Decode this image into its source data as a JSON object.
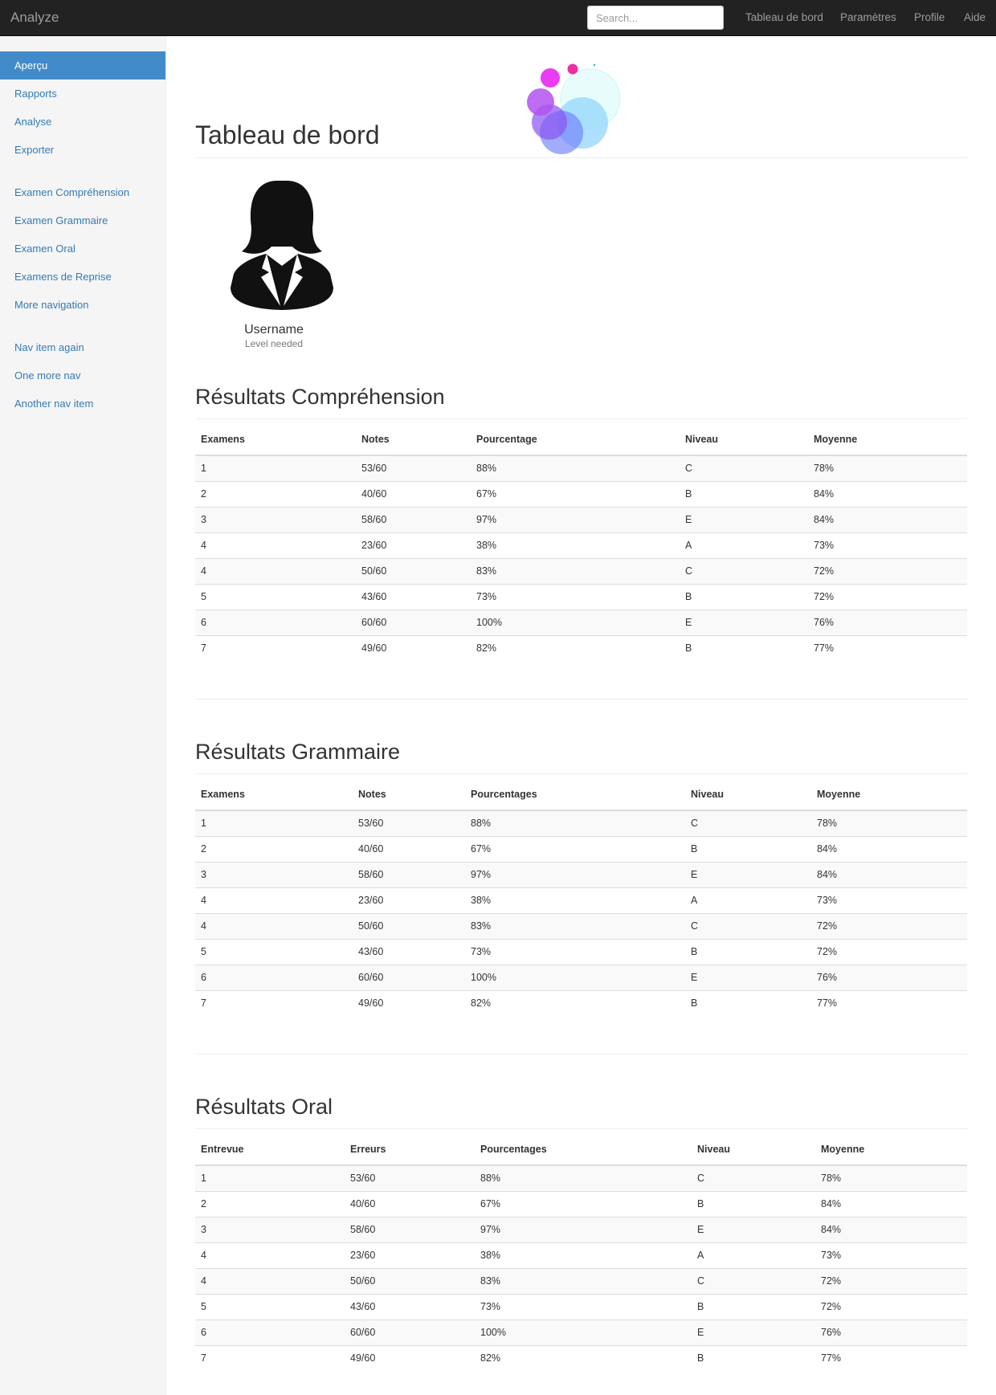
{
  "app": {
    "brand": "Analyze"
  },
  "search": {
    "placeholder": "Search..."
  },
  "topnav": [
    "Tableau de bord",
    "Paramètres",
    "Profile",
    "Aide"
  ],
  "sidebar": {
    "items": [
      "Aperçu",
      "Rapports",
      "Analyse",
      "Exporter",
      "Examen Compréhension",
      "Examen Grammaire",
      "Examen Oral",
      "Examens de Reprise",
      "More navigation",
      "Nav item again",
      "One more nav",
      "Another nav item"
    ],
    "active_index": 0
  },
  "page": {
    "title": "Tableau de bord"
  },
  "profile": {
    "username": "Username",
    "level": "Level needed"
  },
  "sections": [
    {
      "title": "Résultats Compréhension",
      "headers": [
        "Examens",
        "Notes",
        "Pourcentage",
        "Niveau",
        "Moyenne"
      ],
      "rows": [
        [
          "1",
          "53/60",
          "88%",
          "C",
          "78%"
        ],
        [
          "2",
          "40/60",
          "67%",
          "B",
          "84%"
        ],
        [
          "3",
          "58/60",
          "97%",
          "E",
          "84%"
        ],
        [
          "4",
          "23/60",
          "38%",
          "A",
          "73%"
        ],
        [
          "4",
          "50/60",
          "83%",
          "C",
          "72%"
        ],
        [
          "5",
          "43/60",
          "73%",
          "B",
          "72%"
        ],
        [
          "6",
          "60/60",
          "100%",
          "E",
          "76%"
        ],
        [
          "7",
          "49/60",
          "82%",
          "B",
          "77%"
        ]
      ]
    },
    {
      "title": "Résultats Grammaire",
      "headers": [
        "Examens",
        "Notes",
        "Pourcentages",
        "Niveau",
        "Moyenne"
      ],
      "rows": [
        [
          "1",
          "53/60",
          "88%",
          "C",
          "78%"
        ],
        [
          "2",
          "40/60",
          "67%",
          "B",
          "84%"
        ],
        [
          "3",
          "58/60",
          "97%",
          "E",
          "84%"
        ],
        [
          "4",
          "23/60",
          "38%",
          "A",
          "73%"
        ],
        [
          "4",
          "50/60",
          "83%",
          "C",
          "72%"
        ],
        [
          "5",
          "43/60",
          "73%",
          "B",
          "72%"
        ],
        [
          "6",
          "60/60",
          "100%",
          "E",
          "76%"
        ],
        [
          "7",
          "49/60",
          "82%",
          "B",
          "77%"
        ]
      ]
    },
    {
      "title": "Résultats Oral",
      "headers": [
        "Entrevue",
        "Erreurs",
        "Pourcentages",
        "Niveau",
        "Moyenne"
      ],
      "rows": [
        [
          "1",
          "53/60",
          "88%",
          "C",
          "78%"
        ],
        [
          "2",
          "40/60",
          "67%",
          "B",
          "84%"
        ],
        [
          "3",
          "58/60",
          "97%",
          "E",
          "84%"
        ],
        [
          "4",
          "23/60",
          "38%",
          "A",
          "73%"
        ],
        [
          "4",
          "50/60",
          "83%",
          "C",
          "72%"
        ],
        [
          "5",
          "43/60",
          "73%",
          "B",
          "72%"
        ],
        [
          "6",
          "60/60",
          "100%",
          "E",
          "76%"
        ],
        [
          "7",
          "49/60",
          "82%",
          "B",
          "77%"
        ]
      ]
    }
  ],
  "colors": {
    "navbar": "#222222",
    "sidebar": "#f5f5f5",
    "active": "#428bca",
    "link": "#337ab7"
  },
  "icons": {
    "logo": "bubbles-logo-icon",
    "avatar": "female-avatar-icon"
  }
}
